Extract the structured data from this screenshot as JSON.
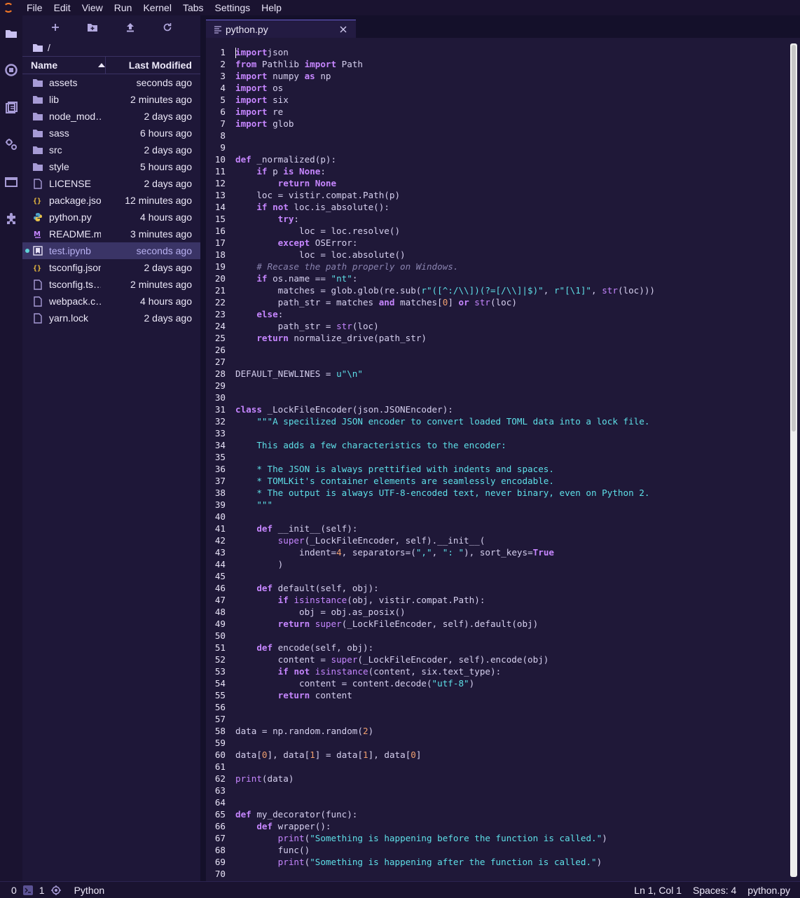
{
  "menubar": {
    "items": [
      "File",
      "Edit",
      "View",
      "Run",
      "Kernel",
      "Tabs",
      "Settings",
      "Help"
    ]
  },
  "leftbar": {
    "icons": [
      "folder-icon",
      "running-icon",
      "commands-icon",
      "property-inspector-icon",
      "tabs-icon",
      "extension-icon"
    ]
  },
  "filebrowser": {
    "breadcrumb": "/",
    "header": {
      "name": "Name",
      "modified": "Last Modified"
    },
    "items": [
      {
        "name": "assets",
        "modified": "seconds ago",
        "type": "folder"
      },
      {
        "name": "lib",
        "modified": "2 minutes ago",
        "type": "folder"
      },
      {
        "name": "node_mod…",
        "modified": "2 days ago",
        "type": "folder"
      },
      {
        "name": "sass",
        "modified": "6 hours ago",
        "type": "folder"
      },
      {
        "name": "src",
        "modified": "2 days ago",
        "type": "folder"
      },
      {
        "name": "style",
        "modified": "5 hours ago",
        "type": "folder"
      },
      {
        "name": "LICENSE",
        "modified": "2 days ago",
        "type": "file"
      },
      {
        "name": "package.json",
        "modified": "12 minutes ago",
        "type": "json"
      },
      {
        "name": "python.py",
        "modified": "4 hours ago",
        "type": "python"
      },
      {
        "name": "README.md",
        "modified": "3 minutes ago",
        "type": "markdown"
      },
      {
        "name": "test.ipynb",
        "modified": "seconds ago",
        "type": "notebook"
      },
      {
        "name": "tsconfig.json",
        "modified": "2 days ago",
        "type": "json"
      },
      {
        "name": "tsconfig.ts…",
        "modified": "2 minutes ago",
        "type": "file"
      },
      {
        "name": "webpack.c…",
        "modified": "4 hours ago",
        "type": "file"
      },
      {
        "name": "yarn.lock",
        "modified": "2 days ago",
        "type": "file"
      }
    ],
    "selected_index": 10
  },
  "tab": {
    "label": "python.py"
  },
  "statusbar": {
    "terminals": "0",
    "kernels": "1",
    "kernel_name": "Python",
    "position": "Ln 1, Col 1",
    "spaces": "Spaces: 4",
    "file": "python.py"
  },
  "editor": {
    "lines": [
      [
        [
          "kw",
          "import"
        ],
        [
          "",
          "json"
        ]
      ],
      [
        [
          "kw",
          "from"
        ],
        [
          "",
          " Pathlib "
        ],
        [
          "kw",
          "import"
        ],
        [
          "",
          " Path"
        ]
      ],
      [
        [
          "kw",
          "import"
        ],
        [
          "",
          " numpy "
        ],
        [
          "kw",
          "as"
        ],
        [
          "",
          " np"
        ]
      ],
      [
        [
          "kw",
          "import"
        ],
        [
          "",
          " os"
        ]
      ],
      [
        [
          "kw",
          "import"
        ],
        [
          "",
          " six"
        ]
      ],
      [
        [
          "kw",
          "import"
        ],
        [
          "",
          " re"
        ]
      ],
      [
        [
          "kw",
          "import"
        ],
        [
          "",
          " glob"
        ]
      ],
      [],
      [],
      [
        [
          "kw",
          "def"
        ],
        [
          "",
          " _normalized(p):"
        ]
      ],
      [
        [
          "",
          "    "
        ],
        [
          "kw",
          "if"
        ],
        [
          "",
          " p "
        ],
        [
          "kw",
          "is"
        ],
        [
          "",
          " "
        ],
        [
          "kw",
          "None"
        ],
        [
          "",
          ":"
        ]
      ],
      [
        [
          "",
          "        "
        ],
        [
          "kw",
          "return"
        ],
        [
          "",
          " "
        ],
        [
          "kw",
          "None"
        ]
      ],
      [
        [
          "",
          "    loc = vistir.compat.Path(p)"
        ]
      ],
      [
        [
          "",
          "    "
        ],
        [
          "kw",
          "if"
        ],
        [
          "",
          " "
        ],
        [
          "kw",
          "not"
        ],
        [
          "",
          " loc.is_absolute():"
        ]
      ],
      [
        [
          "",
          "        "
        ],
        [
          "kw",
          "try"
        ],
        [
          "",
          ":"
        ]
      ],
      [
        [
          "",
          "            loc = loc.resolve()"
        ]
      ],
      [
        [
          "",
          "        "
        ],
        [
          "kw",
          "except"
        ],
        [
          "",
          " OSError:"
        ]
      ],
      [
        [
          "",
          "            loc = loc.absolute()"
        ]
      ],
      [
        [
          "",
          "    "
        ],
        [
          "cm",
          "# Recase the path properly on Windows."
        ]
      ],
      [
        [
          "",
          "    "
        ],
        [
          "kw",
          "if"
        ],
        [
          "",
          " os.name == "
        ],
        [
          "st",
          "\"nt\""
        ],
        [
          "",
          ":"
        ]
      ],
      [
        [
          "",
          "        matches = glob.glob(re.sub("
        ],
        [
          "st",
          "r\"([^:/\\\\])(?=[/\\\\]|$)\""
        ],
        [
          "",
          ", "
        ],
        [
          "st",
          "r\"[\\1]\""
        ],
        [
          "",
          ", "
        ],
        [
          "bi",
          "str"
        ],
        [
          "",
          "(loc)))"
        ]
      ],
      [
        [
          "",
          "        path_str = matches "
        ],
        [
          "kw",
          "and"
        ],
        [
          "",
          " matches["
        ],
        [
          "nm",
          "0"
        ],
        [
          "",
          "] "
        ],
        [
          "kw",
          "or"
        ],
        [
          "",
          " "
        ],
        [
          "bi",
          "str"
        ],
        [
          "",
          "(loc)"
        ]
      ],
      [
        [
          "",
          "    "
        ],
        [
          "kw",
          "else"
        ],
        [
          "",
          ":"
        ]
      ],
      [
        [
          "",
          "        path_str = "
        ],
        [
          "bi",
          "str"
        ],
        [
          "",
          "(loc)"
        ]
      ],
      [
        [
          "",
          "    "
        ],
        [
          "kw",
          "return"
        ],
        [
          "",
          " normalize_drive(path_str)"
        ]
      ],
      [],
      [],
      [
        [
          "",
          "DEFAULT_NEWLINES = "
        ],
        [
          "st",
          "u\"\\n\""
        ]
      ],
      [],
      [],
      [
        [
          "kw",
          "class"
        ],
        [
          "",
          " _LockFileEncoder(json.JSONEncoder):"
        ]
      ],
      [
        [
          "",
          "    "
        ],
        [
          "st",
          "\"\"\"A specilized JSON encoder to convert loaded TOML data into a lock file."
        ]
      ],
      [],
      [
        [
          "",
          "    "
        ],
        [
          "st",
          "This adds a few characteristics to the encoder:"
        ]
      ],
      [],
      [
        [
          "",
          "    "
        ],
        [
          "st",
          "* The JSON is always prettified with indents and spaces."
        ]
      ],
      [
        [
          "",
          "    "
        ],
        [
          "st",
          "* TOMLKit's container elements are seamlessly encodable."
        ]
      ],
      [
        [
          "",
          "    "
        ],
        [
          "st",
          "* The output is always UTF-8-encoded text, never binary, even on Python 2."
        ]
      ],
      [
        [
          "",
          "    "
        ],
        [
          "st",
          "\"\"\""
        ]
      ],
      [],
      [
        [
          "",
          "    "
        ],
        [
          "kw",
          "def"
        ],
        [
          "",
          " __init__(self):"
        ]
      ],
      [
        [
          "",
          "        "
        ],
        [
          "bi",
          "super"
        ],
        [
          "",
          "(_LockFileEncoder, self).__init__("
        ]
      ],
      [
        [
          "",
          "            indent="
        ],
        [
          "nm",
          "4"
        ],
        [
          "",
          ", separators=("
        ],
        [
          "st",
          "\",\""
        ],
        [
          "",
          ", "
        ],
        [
          "st",
          "\": \""
        ],
        [
          "",
          "), sort_keys="
        ],
        [
          "kw",
          "True"
        ]
      ],
      [
        [
          "",
          "        )"
        ]
      ],
      [],
      [
        [
          "",
          "    "
        ],
        [
          "kw",
          "def"
        ],
        [
          "",
          " default(self, obj):"
        ]
      ],
      [
        [
          "",
          "        "
        ],
        [
          "kw",
          "if"
        ],
        [
          "",
          " "
        ],
        [
          "bi",
          "isinstance"
        ],
        [
          "",
          "(obj, vistir.compat.Path):"
        ]
      ],
      [
        [
          "",
          "            obj = obj.as_posix()"
        ]
      ],
      [
        [
          "",
          "        "
        ],
        [
          "kw",
          "return"
        ],
        [
          "",
          " "
        ],
        [
          "bi",
          "super"
        ],
        [
          "",
          "(_LockFileEncoder, self).default(obj)"
        ]
      ],
      [],
      [
        [
          "",
          "    "
        ],
        [
          "kw",
          "def"
        ],
        [
          "",
          " encode(self, obj):"
        ]
      ],
      [
        [
          "",
          "        content = "
        ],
        [
          "bi",
          "super"
        ],
        [
          "",
          "(_LockFileEncoder, self).encode(obj)"
        ]
      ],
      [
        [
          "",
          "        "
        ],
        [
          "kw",
          "if"
        ],
        [
          "",
          " "
        ],
        [
          "kw",
          "not"
        ],
        [
          "",
          " "
        ],
        [
          "bi",
          "isinstance"
        ],
        [
          "",
          "(content, six.text_type):"
        ]
      ],
      [
        [
          "",
          "            content = content.decode("
        ],
        [
          "st",
          "\"utf-8\""
        ],
        [
          "",
          ")"
        ]
      ],
      [
        [
          "",
          "        "
        ],
        [
          "kw",
          "return"
        ],
        [
          "",
          " content"
        ]
      ],
      [],
      [],
      [
        [
          "",
          "data = np.random.random("
        ],
        [
          "nm",
          "2"
        ],
        [
          "",
          ")"
        ]
      ],
      [],
      [
        [
          "",
          "data["
        ],
        [
          "nm",
          "0"
        ],
        [
          "",
          "], data["
        ],
        [
          "nm",
          "1"
        ],
        [
          "",
          "] = data["
        ],
        [
          "nm",
          "1"
        ],
        [
          "",
          "], data["
        ],
        [
          "nm",
          "0"
        ],
        [
          "",
          "]"
        ]
      ],
      [],
      [
        [
          "bi",
          "print"
        ],
        [
          "",
          "(data)"
        ]
      ],
      [],
      [],
      [
        [
          "kw",
          "def"
        ],
        [
          "",
          " my_decorator(func):"
        ]
      ],
      [
        [
          "",
          "    "
        ],
        [
          "kw",
          "def"
        ],
        [
          "",
          " wrapper():"
        ]
      ],
      [
        [
          "",
          "        "
        ],
        [
          "bi",
          "print"
        ],
        [
          "",
          "("
        ],
        [
          "st",
          "\"Something is happening before the function is called.\""
        ],
        [
          "",
          ")"
        ]
      ],
      [
        [
          "",
          "        func()"
        ]
      ],
      [
        [
          "",
          "        "
        ],
        [
          "bi",
          "print"
        ],
        [
          "",
          "("
        ],
        [
          "st",
          "\"Something is happening after the function is called.\""
        ],
        [
          "",
          ")"
        ]
      ],
      []
    ]
  }
}
